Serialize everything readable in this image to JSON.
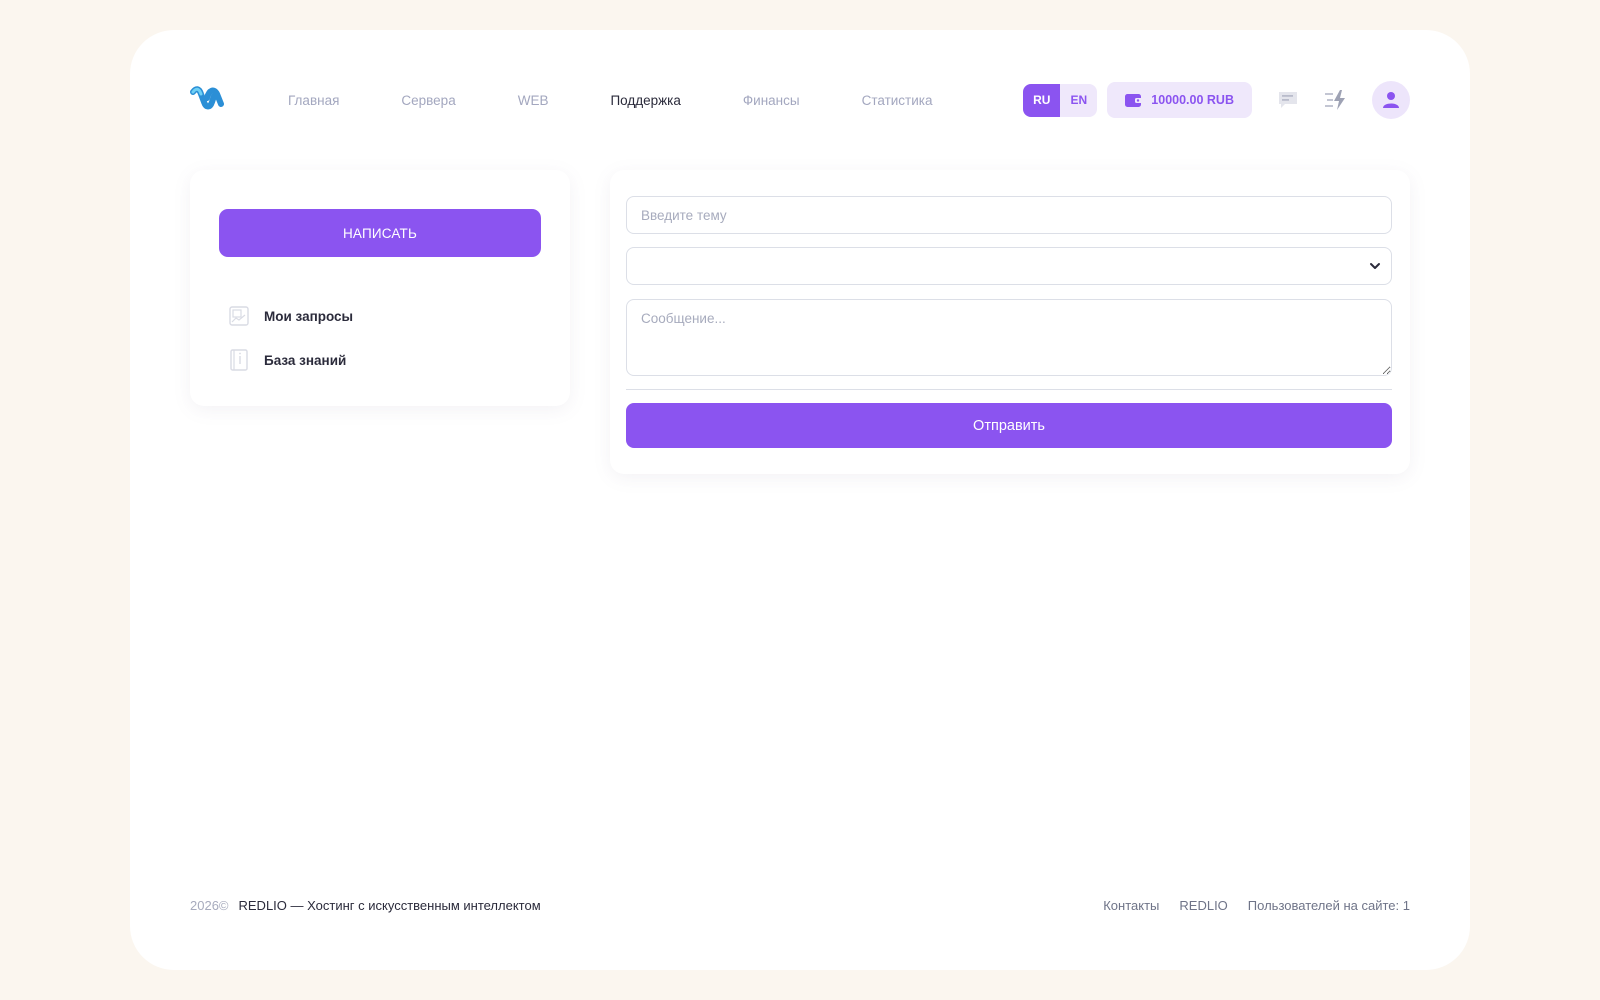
{
  "header": {
    "logo_icon": "wave-logo-icon",
    "nav": [
      {
        "label": "Главная",
        "active": false
      },
      {
        "label": "Сервера",
        "active": false
      },
      {
        "label": "WEB",
        "active": false
      },
      {
        "label": "Поддержка",
        "active": true
      },
      {
        "label": "Финансы",
        "active": false
      },
      {
        "label": "Статистика",
        "active": false
      }
    ],
    "lang": {
      "ru": "RU",
      "en": "EN",
      "selected": "RU"
    },
    "balance": "10000.00 RUB",
    "icons": [
      "wallet-icon",
      "chat-icon",
      "lightning-icon",
      "user-icon"
    ]
  },
  "sidebar": {
    "write_button": "НАПИСАТЬ",
    "items": [
      {
        "label": "Мои запросы",
        "icon": "requests-icon"
      },
      {
        "label": "База знаний",
        "icon": "knowledge-base-icon"
      }
    ]
  },
  "form": {
    "subject_placeholder": "Введите тему",
    "category_value": "",
    "message_placeholder": "Сообщение...",
    "submit_label": "Отправить"
  },
  "footer": {
    "year": "2026©",
    "tagline": "REDLIO — Хостинг с искусственным интеллектом",
    "links": [
      "Контакты",
      "REDLIO"
    ],
    "online_label": "Пользователей на сайте: 1"
  },
  "colors": {
    "accent": "#8b54f0",
    "accent_light": "#efe8fb",
    "background": "#fbf6ef",
    "muted_text": "#a3a7bf"
  }
}
